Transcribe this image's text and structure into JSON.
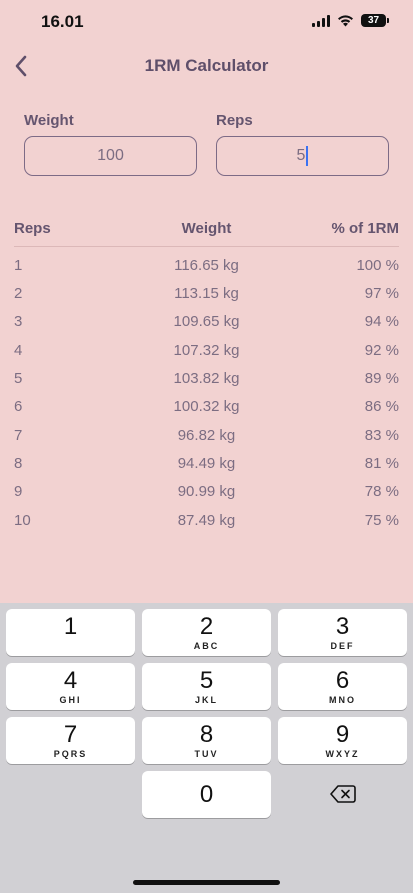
{
  "status_bar": {
    "time": "16.01",
    "battery": "37",
    "icons": [
      "signal-icon",
      "wifi-icon",
      "battery-icon"
    ]
  },
  "header": {
    "title": "1RM Calculator",
    "back_icon": "chevron-left-icon"
  },
  "inputs": {
    "weight": {
      "label": "Weight",
      "value": "100"
    },
    "reps": {
      "label": "Reps",
      "value": "5"
    }
  },
  "table": {
    "headers": {
      "reps": "Reps",
      "weight": "Weight",
      "percent": "% of 1RM"
    },
    "rows": [
      {
        "reps": "1",
        "weight": "116.65 kg",
        "percent": "100 %"
      },
      {
        "reps": "2",
        "weight": "113.15 kg",
        "percent": "97 %"
      },
      {
        "reps": "3",
        "weight": "109.65 kg",
        "percent": "94 %"
      },
      {
        "reps": "4",
        "weight": "107.32 kg",
        "percent": "92 %"
      },
      {
        "reps": "5",
        "weight": "103.82 kg",
        "percent": "89 %"
      },
      {
        "reps": "6",
        "weight": "100.32 kg",
        "percent": "86 %"
      },
      {
        "reps": "7",
        "weight": "96.82 kg",
        "percent": "83 %"
      },
      {
        "reps": "8",
        "weight": "94.49 kg",
        "percent": "81 %"
      },
      {
        "reps": "9",
        "weight": "90.99 kg",
        "percent": "78 %"
      },
      {
        "reps": "10",
        "weight": "87.49 kg",
        "percent": "75 %"
      }
    ]
  },
  "keyboard": {
    "keys": [
      {
        "digit": "1",
        "letters": ""
      },
      {
        "digit": "2",
        "letters": "ABC"
      },
      {
        "digit": "3",
        "letters": "DEF"
      },
      {
        "digit": "4",
        "letters": "GHI"
      },
      {
        "digit": "5",
        "letters": "JKL"
      },
      {
        "digit": "6",
        "letters": "MNO"
      },
      {
        "digit": "7",
        "letters": "PQRS"
      },
      {
        "digit": "8",
        "letters": "TUV"
      },
      {
        "digit": "9",
        "letters": "WXYZ"
      },
      {
        "digit": "0",
        "letters": ""
      }
    ],
    "delete_icon": "backspace-icon"
  },
  "colors": {
    "background": "#f2d2d1",
    "text": "#6a5a72",
    "caret": "#3b72f2",
    "keyboard_bg": "#d1d0d4"
  }
}
